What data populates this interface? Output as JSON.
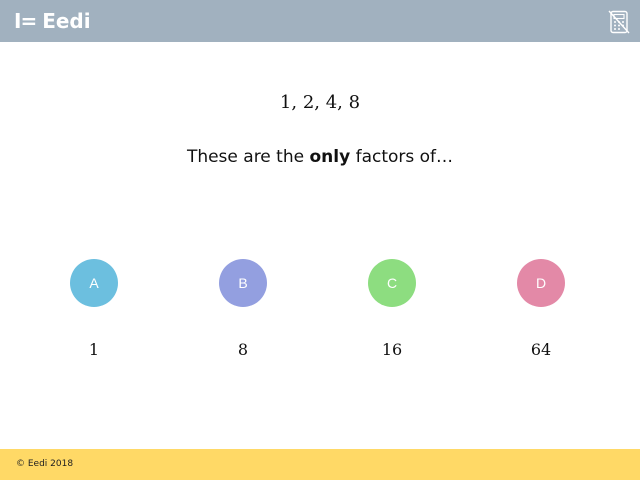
{
  "header": {
    "logo_mark": "I=",
    "logo_text": "Eedi",
    "calculator_icon": "no-calculator-icon",
    "background_color": "#a1b1bf"
  },
  "question": {
    "sequence": "1, 2, 4, 8",
    "prefix": "These are the ",
    "emphasis": "only",
    "suffix": " factors of…"
  },
  "options": [
    {
      "letter": "A",
      "value": "1",
      "color": "#6cbfdf"
    },
    {
      "letter": "B",
      "value": "8",
      "color": "#939fe0"
    },
    {
      "letter": "C",
      "value": "16",
      "color": "#8ddd80"
    },
    {
      "letter": "D",
      "value": "64",
      "color": "#e389a7"
    }
  ],
  "footer": {
    "copyright": "© Eedi 2018",
    "background_color": "#ffd966"
  }
}
